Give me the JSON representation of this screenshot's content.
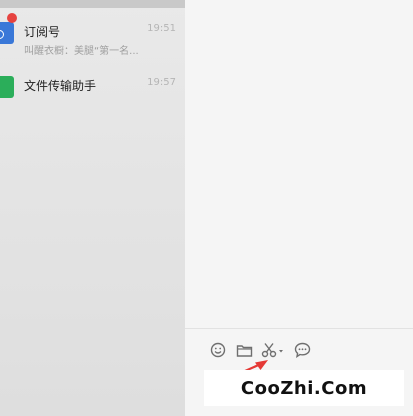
{
  "conversations": [
    {
      "name": "订阅号",
      "preview": "叫醒衣橱：美腿“第一名...",
      "time": "19:51",
      "unread": true
    },
    {
      "name": "文件传输助手",
      "preview": "",
      "time": "19:57",
      "unread": false
    }
  ],
  "toolbar": {
    "icons": [
      "emoji-icon",
      "folder-icon",
      "scissors-icon",
      "chat-bubble-icon"
    ]
  },
  "watermark": "CooZhi.Com",
  "colors": {
    "accent_blue": "#3a78d8",
    "accent_green": "#2bae5a",
    "unread_red": "#e64340",
    "annotation_arrow": "#e53935"
  }
}
